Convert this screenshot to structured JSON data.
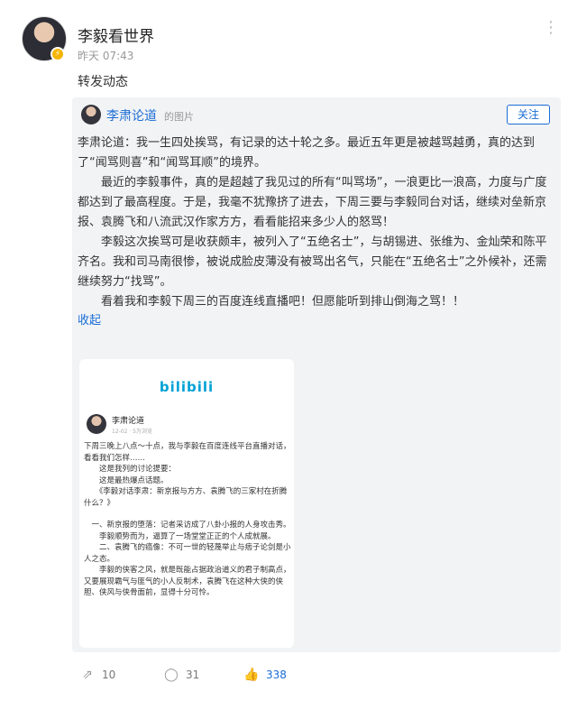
{
  "user": {
    "name": "李毅看世界",
    "time": "昨天 07:43"
  },
  "post": {
    "text": "转发动态"
  },
  "repost": {
    "author": "李肃论道",
    "suffix": "的图片",
    "follow_label": "关注",
    "paragraphs": [
      "李肃论道：我一生四处挨骂，有记录的达十轮之多。最近五年更是被越骂越勇，真的达到了“闻骂则喜”和“闻骂耳顺”的境界。",
      "　　最近的李毅事件，真的是超越了我见过的所有“叫骂场”，一浪更比一浪高，力度与广度都达到了最高程度。于是，我毫不犹豫挤了进去，下周三要与李毅同台对话，继续对垒新京报、袁腾飞和八流武汉作家方方，看看能招来多少人的怒骂！",
      "　　李毅这次挨骂可是收获颇丰，被列入了“五绝名士”，与胡锡进、张维为、金灿荣和陈平齐名。我和司马南很惨，被说成脸皮薄没有被骂出名气，只能在“五绝名士”之外候补，还需继续努力“找骂”。",
      "　　看着我和李毅下周三的百度连线直播吧！但愿能听到排山倒海之骂！！"
    ],
    "collapse_label": "收起"
  },
  "image": {
    "logo": "bilibili",
    "author": "李肃论道",
    "meta": "12-02 · 5万浏览",
    "lines": [
      "下周三晚上八点～十点，我与李毅在百度连线平台直播对话，看看我们怎样……",
      "　　这是我列的讨论提要：",
      "　　这是最热爆点话题。",
      "　　《李毅对话李肃：新京报与方方、袁腾飞的三家村在折腾什么？》",
      "",
      "　一、新京报的堕落：记者采访成了八卦小报的人身攻击秀。",
      "　　李毅顺势而为，逼算了一场堂堂正正的个人成就展。",
      "　　二、袁腾飞的癌像：不可一世的轻蔑举止与痞子论剑是小人之态。",
      "　　李毅的侠客之风，就是既能占据政治道义的君子制高点，又要展现霸气与匪气的小人反制术，袁腾飞在这种大侠的侠胆、侠风与侠骨面前，显得十分可怜。"
    ]
  },
  "actions": {
    "repost_count": "10",
    "comment_count": "31",
    "like_count": "338"
  },
  "colors": {
    "accent": "#1a6dd6",
    "bilibili": "#00a1d6"
  }
}
